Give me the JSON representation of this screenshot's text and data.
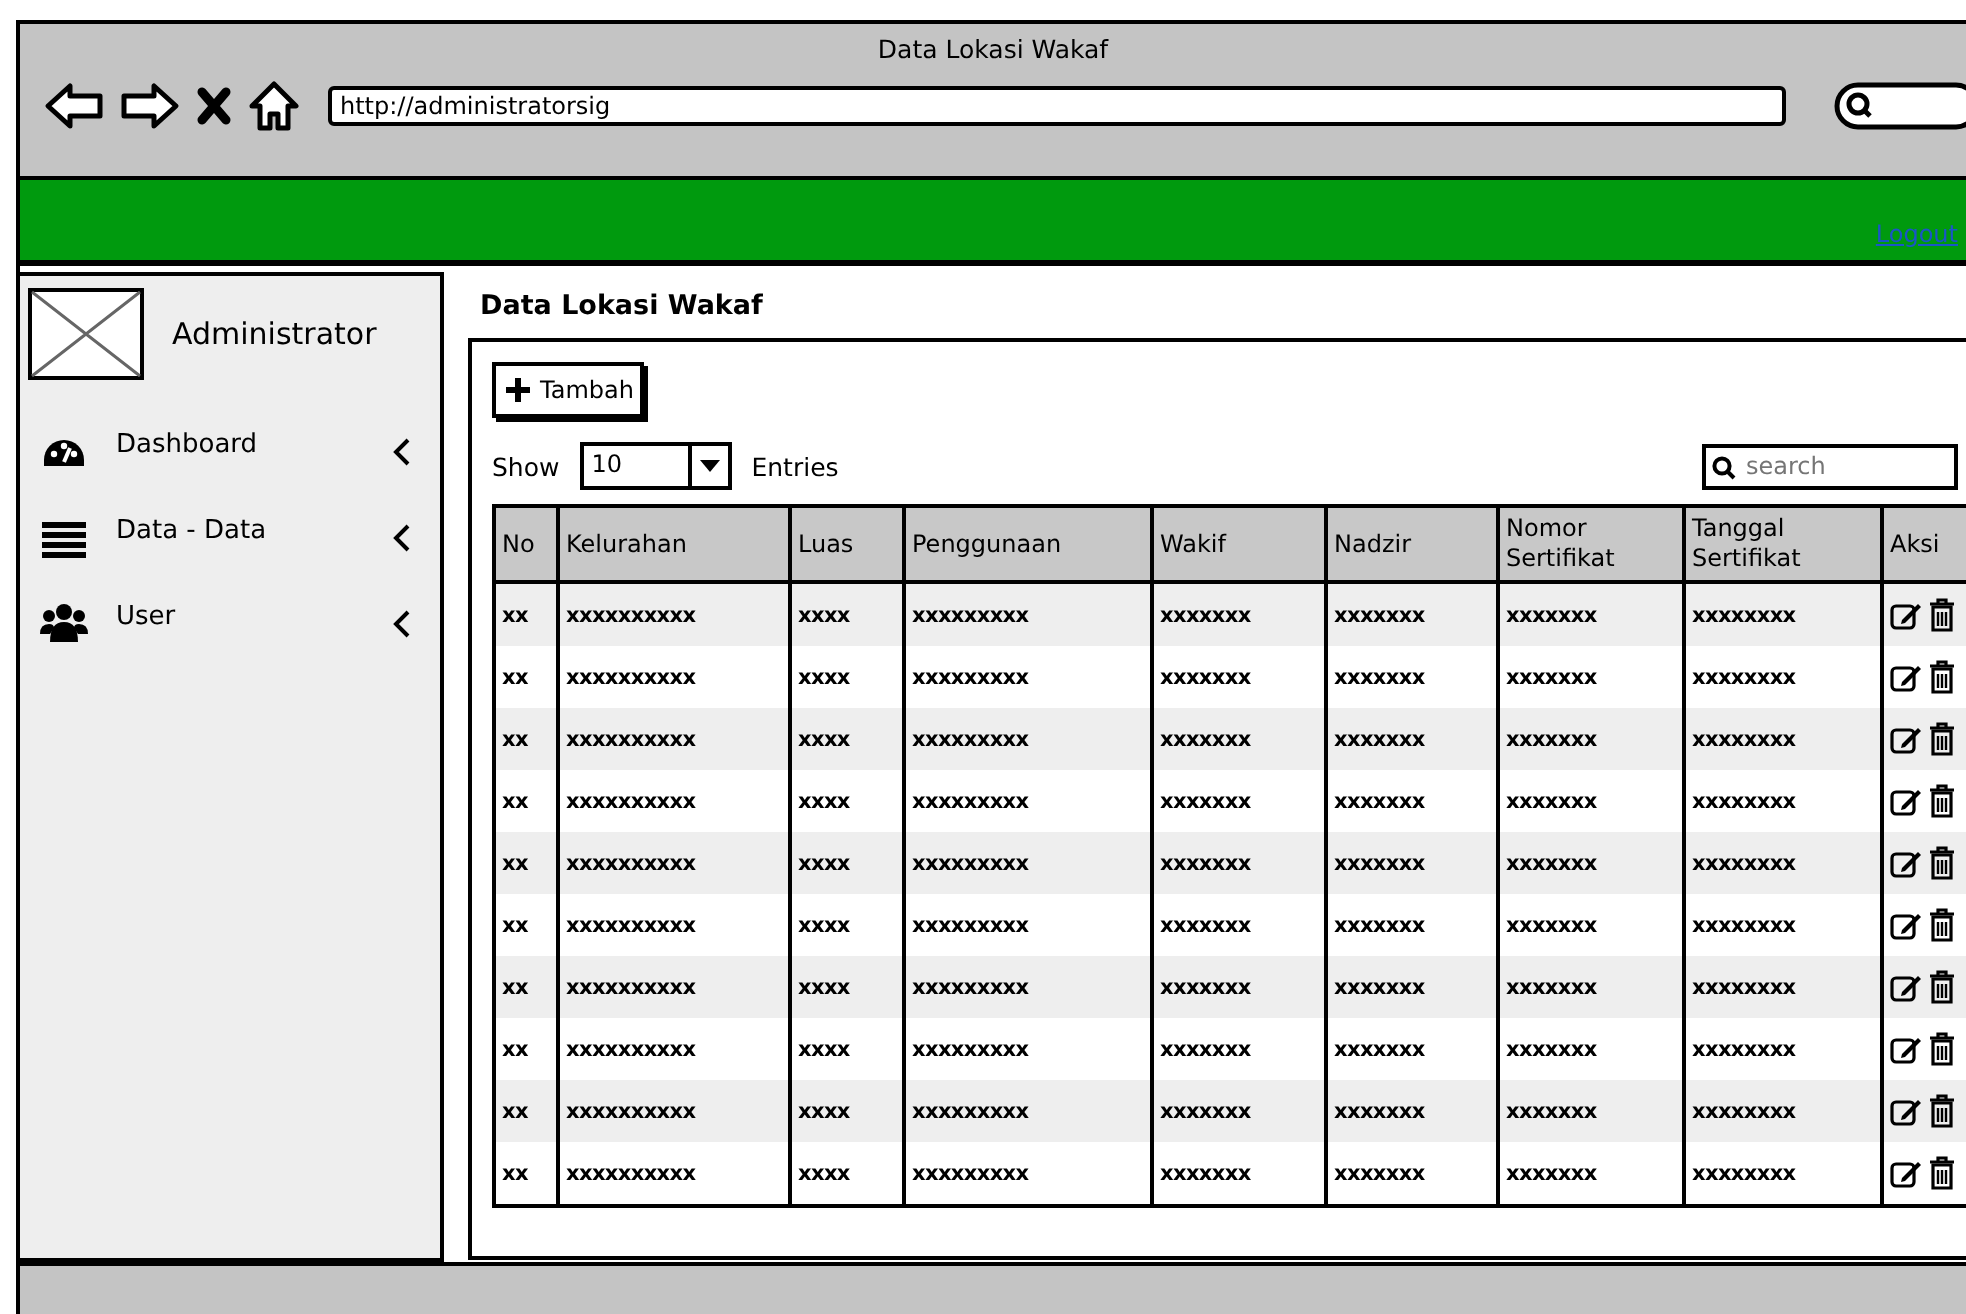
{
  "window": {
    "title": "Data Lokasi Wakaf",
    "url": "http://administratorsig"
  },
  "header": {
    "logout": "Logout"
  },
  "sidebar": {
    "user": "Administrator",
    "items": [
      {
        "label": "Dashboard",
        "expanded": false
      },
      {
        "label": "Data - Data",
        "expanded": false
      },
      {
        "label": "User",
        "expanded": false
      }
    ]
  },
  "page": {
    "title": "Data Lokasi Wakaf",
    "add_button": "Tambah",
    "show_label": "Show",
    "page_size": "10",
    "entries_label": "Entries",
    "search": {
      "placeholder": "search"
    }
  },
  "table": {
    "columns": [
      "No",
      "Kelurahan",
      "Luas",
      "Penggunaan",
      "Wakif",
      "Nadzir",
      "Nomor Sertifikat",
      "Tanggal Sertifikat",
      "Aksi"
    ],
    "rows": [
      [
        "xx",
        "xxxxxxxxxx",
        "xxxx",
        "xxxxxxxxx",
        "xxxxxxx",
        "xxxxxxx",
        "xxxxxxx",
        "xxxxxxxx"
      ],
      [
        "xx",
        "xxxxxxxxxx",
        "xxxx",
        "xxxxxxxxx",
        "xxxxxxx",
        "xxxxxxx",
        "xxxxxxx",
        "xxxxxxxx"
      ],
      [
        "xx",
        "xxxxxxxxxx",
        "xxxx",
        "xxxxxxxxx",
        "xxxxxxx",
        "xxxxxxx",
        "xxxxxxx",
        "xxxxxxxx"
      ],
      [
        "xx",
        "xxxxxxxxxx",
        "xxxx",
        "xxxxxxxxx",
        "xxxxxxx",
        "xxxxxxx",
        "xxxxxxx",
        "xxxxxxxx"
      ],
      [
        "xx",
        "xxxxxxxxxx",
        "xxxx",
        "xxxxxxxxx",
        "xxxxxxx",
        "xxxxxxx",
        "xxxxxxx",
        "xxxxxxxx"
      ],
      [
        "xx",
        "xxxxxxxxxx",
        "xxxx",
        "xxxxxxxxx",
        "xxxxxxx",
        "xxxxxxx",
        "xxxxxxx",
        "xxxxxxxx"
      ],
      [
        "xx",
        "xxxxxxxxxx",
        "xxxx",
        "xxxxxxxxx",
        "xxxxxxx",
        "xxxxxxx",
        "xxxxxxx",
        "xxxxxxxx"
      ],
      [
        "xx",
        "xxxxxxxxxx",
        "xxxx",
        "xxxxxxxxx",
        "xxxxxxx",
        "xxxxxxx",
        "xxxxxxx",
        "xxxxxxxx"
      ],
      [
        "xx",
        "xxxxxxxxxx",
        "xxxx",
        "xxxxxxxxx",
        "xxxxxxx",
        "xxxxxxx",
        "xxxxxxx",
        "xxxxxxxx"
      ],
      [
        "xx",
        "xxxxxxxxxx",
        "xxxx",
        "xxxxxxxxx",
        "xxxxxxx",
        "xxxxxxx",
        "xxxxxxx",
        "xxxxxxxx"
      ]
    ]
  }
}
